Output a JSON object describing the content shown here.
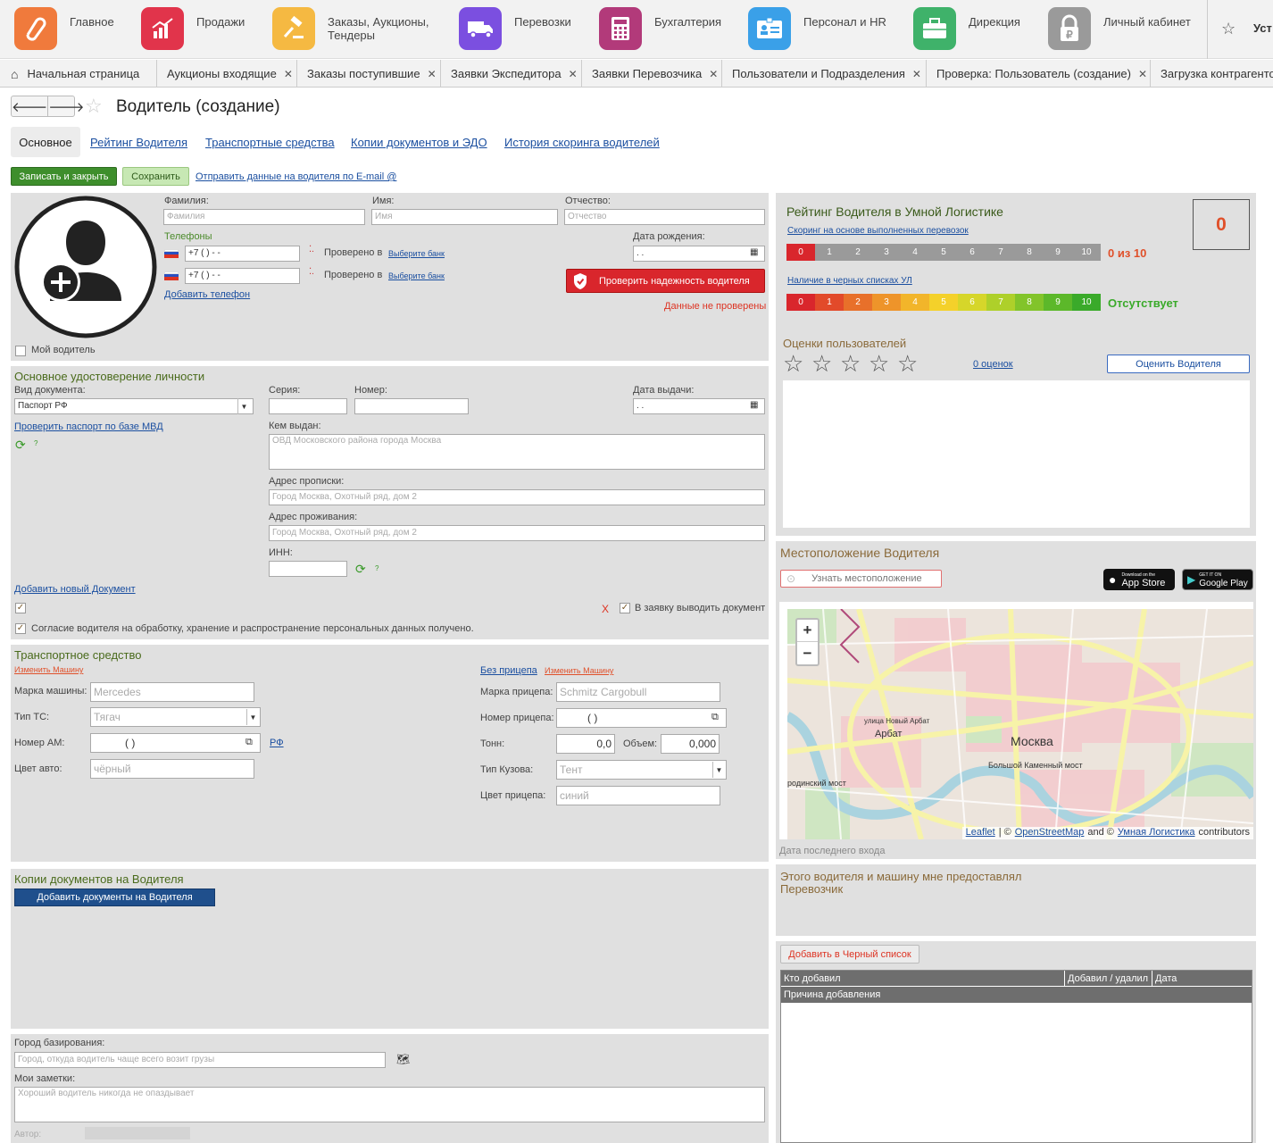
{
  "nav": [
    {
      "label": "Главное",
      "icon": "logo-icon",
      "color": "#f07a3c"
    },
    {
      "label": "Продажи",
      "icon": "sales-chart-icon",
      "color": "#e1344b"
    },
    {
      "label": "Заказы,  Аукционы, Тендеры",
      "icon": "gavel-icon",
      "color": "#f5b942"
    },
    {
      "label": "Перевозки",
      "icon": "truck-icon",
      "color": "#7b4fe0"
    },
    {
      "label": "Бухгалтерия",
      "icon": "calculator-icon",
      "color": "#b23a7a"
    },
    {
      "label": "Персонал и HR",
      "icon": "id-card-icon",
      "color": "#3aa0e8"
    },
    {
      "label": "Дирекция",
      "icon": "briefcase-icon",
      "color": "#3fb26a"
    },
    {
      "label": "Личный кабинет",
      "icon": "lock-ruble-icon",
      "color": "#9a9a9a"
    },
    {
      "label": "Уст",
      "icon": "star-icon",
      "color": "#555"
    }
  ],
  "tabs": [
    {
      "label": "Начальная страница"
    },
    {
      "label": "Аукционы входящие"
    },
    {
      "label": "Заказы поступившие"
    },
    {
      "label": "Заявки Экспедитора"
    },
    {
      "label": "Заявки Перевозчика"
    },
    {
      "label": "Пользователи и Подразделения"
    },
    {
      "label": "Проверка: Пользователь (создание)"
    },
    {
      "label": "Загрузка контрагенто"
    }
  ],
  "page": {
    "title": "Водитель (создание)",
    "subtabs": [
      "Основное",
      "Рейтинг Водителя",
      "Транспортные средства",
      "Копии документов и ЭДО",
      "История скоринга водителей"
    ],
    "btn_save_close": "Записать и закрыть",
    "btn_save": "Сохранить",
    "send_email": "Отправить данные на водителя по E-mail @"
  },
  "person": {
    "surname_label": "Фамилия:",
    "surname_ph": "Фамилия",
    "name_label": "Имя:",
    "name_ph": "Имя",
    "patronymic_label": "Отчество:",
    "patronymic_ph": "Отчество",
    "phones_label": "Телефоны",
    "phone1": "+7 (   )    -   -",
    "phone2": "+7 (   )    -   -",
    "checked_in": "Проверено в",
    "choose_bank": "Выберите банк",
    "add_phone": "Добавить телефон",
    "birth_label": "Дата рождения:",
    "birth_val": " .  .",
    "check_btn": "Проверить надежность водителя",
    "not_checked": "Данные не проверены",
    "my_driver": "Мой водитель"
  },
  "id_doc": {
    "title": "Основное удостоверение личности",
    "type_label": "Вид документа:",
    "type_val": "Паспорт РФ",
    "series_label": "Серия:",
    "number_label": "Номер:",
    "issue_date_label": "Дата выдачи:",
    "issue_date_val": " .  .",
    "check_mvd": "Проверить паспорт по базе МВД",
    "issued_by_label": "Кем выдан:",
    "issued_by_ph": "ОВД Московского района города Москва",
    "reg_label": "Адрес прописки:",
    "reg_ph": "Город Москва, Охотный ряд, дом 2",
    "live_label": "Адрес проживания:",
    "live_ph": "Город Москва, Охотный ряд, дом 2",
    "inn_label": "ИНН:",
    "add_doc": "Добавить новый Документ",
    "x_mark": "Х",
    "to_request": "В заявку выводить документ",
    "consent": "Согласие водителя на обработку, хранение и распространение персональных данных получено."
  },
  "vehicle": {
    "title": "Транспортное средство",
    "change": "Изменить Машину",
    "brand_label": "Марка машины:",
    "brand_ph": "Mercedes",
    "type_label": "Тип ТС:",
    "type_ph": "Тягач",
    "number_label": "Номер АМ:",
    "number_val": "(    )",
    "rf": "РФ",
    "color_label": "Цвет авто:",
    "color_ph": "чёрный",
    "no_trailer": "Без прицепа",
    "change2": "Изменить Машину",
    "trailer_brand_label": "Марка прицепа:",
    "trailer_brand_ph": "Schmitz Cargobull",
    "trailer_num_label": "Номер прицепа:",
    "trailer_num_val": "(    )",
    "tons_label": "Тонн:",
    "tons_val": "0,0",
    "volume_label": "Объем:",
    "volume_val": "0,000",
    "body_label": "Тип Кузова:",
    "body_ph": "Тент",
    "trailer_color_label": "Цвет прицепа:",
    "trailer_color_ph": "синий"
  },
  "docs": {
    "title": "Копии документов на Водителя",
    "add_btn": "Добавить документы на Водителя"
  },
  "bottom": {
    "city_label": "Город базирования:",
    "city_ph": "Город, откуда водитель чаще всего возит грузы",
    "notes_label": "Мои заметки:",
    "notes_ph": "Хороший водитель никогда не опаздывает",
    "author_label": "Автор:"
  },
  "rating": {
    "title": "Рейтинг Водителя в Умной Логистике",
    "score": "0",
    "scoring_link": "Скоринг на основе выполненных перевозок",
    "scale1": [
      "0",
      "1",
      "2",
      "3",
      "4",
      "5",
      "6",
      "7",
      "8",
      "9",
      "10"
    ],
    "score_text": "0 из 10",
    "blacklist_link": "Наличие в черных списках УЛ",
    "absent": "Отсутствует",
    "user_ratings": "Оценки пользователей",
    "ratings_count": "0 оценок",
    "rate_btn": "Оценить Водителя",
    "stars_filled": 0
  },
  "location": {
    "title": "Местоположение Водителя",
    "find_btn": "Узнать местоположение",
    "appstore_small": "Download on the",
    "appstore": "App Store",
    "gplay_small": "GET IT ON",
    "gplay": "Google Play",
    "map_labels": {
      "moscow": "Москва",
      "arbat": "Арбат",
      "new_arbat": "улица Новый Арбат",
      "bridge": "Большой Каменный мост",
      "borodino": "родинский мост"
    },
    "attribution": [
      "Leaflet",
      "|  ©",
      "OpenStreetMap",
      "and ©",
      "Умная Логистика",
      "contributors"
    ],
    "last_login": "Дата последнего входа"
  },
  "provider": {
    "text": "Этого водителя и машину мне предоставлял",
    "role": "Перевозчик"
  },
  "blacklist": {
    "add_btn": "Добавить в Черный список",
    "cols": [
      "Кто добавил",
      "Добавил / удалил",
      "Дата"
    ],
    "reason": "Причина добавления"
  }
}
